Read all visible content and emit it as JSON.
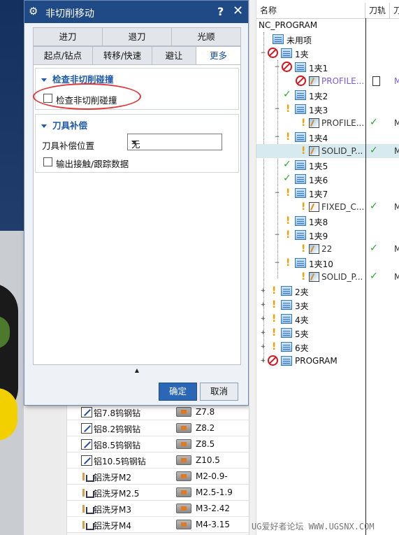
{
  "dialog": {
    "title": "非切削移动",
    "help": "?",
    "close": "✕",
    "tabs_row1": [
      "进刀",
      "退刀",
      "光顺"
    ],
    "tabs_row2": [
      "起点/钻点",
      "转移/快速",
      "避让",
      "更多"
    ],
    "active_tab": "更多",
    "section_collision": {
      "header": "检查非切削碰撞",
      "checkbox_label": "检查非切削碰撞",
      "checked": false
    },
    "section_comp": {
      "header": "刀具补偿",
      "position_label": "刀具补偿位置",
      "position_value": "无",
      "output_label": "输出接触/跟踪数据",
      "output_checked": false
    },
    "collapse_glyph": "▲",
    "ok_label": "确定",
    "cancel_label": "取消"
  },
  "tool_list": {
    "rows": [
      {
        "name": "铝7.8钨钢钻",
        "value": "Z7.8",
        "type": "drill"
      },
      {
        "name": "铝8.2钨钢钻",
        "value": "Z8.2",
        "type": "drill"
      },
      {
        "name": "铝8.5钨钢钻",
        "value": "Z8.5",
        "type": "drill"
      },
      {
        "name": "铝10.5钨钢钻",
        "value": "Z10.5",
        "type": "drill"
      },
      {
        "name": "铝洗牙M2",
        "value": "M2-0.9-",
        "type": "mill"
      },
      {
        "name": "铝洗牙M2.5",
        "value": "M2.5-1.9",
        "type": "mill"
      },
      {
        "name": "铝洗牙M3",
        "value": "M3-2.42",
        "type": "mill"
      },
      {
        "name": "铝洗牙M4",
        "value": "M4-3.15",
        "type": "mill"
      }
    ]
  },
  "navigator": {
    "columns": [
      "名称",
      "刀轨",
      "刀"
    ],
    "rows": [
      {
        "label": "NC_PROGRAM"
      },
      {
        "label": "未用项"
      },
      {
        "label": "1夹"
      },
      {
        "label": "1夹1"
      },
      {
        "label": "PROFILE...",
        "col3": "M"
      },
      {
        "label": "1夹2"
      },
      {
        "label": "1夹3"
      },
      {
        "label": "PROFILE...",
        "col3": "M"
      },
      {
        "label": "1夹4"
      },
      {
        "label": "SOLID_P...",
        "col3": "M"
      },
      {
        "label": "1夹5"
      },
      {
        "label": "1夹6"
      },
      {
        "label": "1夹7"
      },
      {
        "label": "FIXED_C...",
        "col3": "M"
      },
      {
        "label": "1夹8"
      },
      {
        "label": "1夹9"
      },
      {
        "label": "22",
        "col3": "M"
      },
      {
        "label": "1夹10"
      },
      {
        "label": "SOLID_P...",
        "col3": "M"
      },
      {
        "label": "2夹"
      },
      {
        "label": "3夹"
      },
      {
        "label": "4夹"
      },
      {
        "label": "5夹"
      },
      {
        "label": "6夹"
      },
      {
        "label": "PROGRAM"
      }
    ]
  },
  "watermark": "UG爱好者论坛 WWW.UGSNX.COM",
  "colors": {
    "title_bar": "#1f4a86",
    "section_header": "#1e5aa8",
    "annotation_ellipse": "#e0353a",
    "ok_check": "#2da42d",
    "warning": "#f0a000",
    "error": "#d4161c"
  }
}
